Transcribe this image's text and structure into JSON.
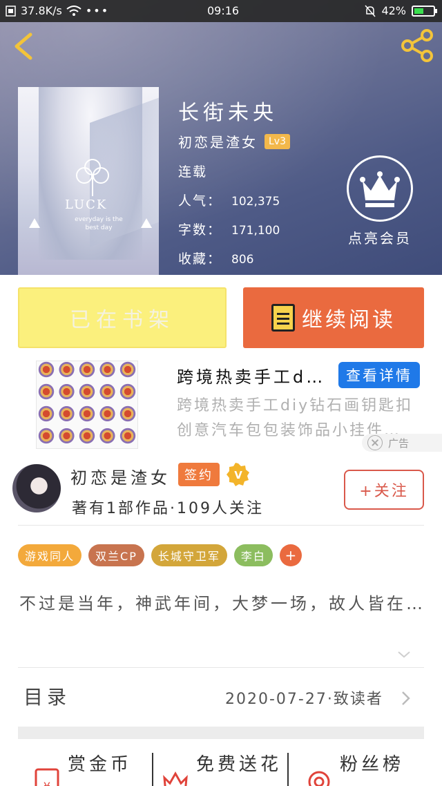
{
  "status_bar": {
    "net_speed": "37.8K/s",
    "time": "09:16",
    "battery": "42%"
  },
  "book": {
    "title": "长街未央",
    "author": "初恋是渣女",
    "level": "Lv3",
    "status": "连载",
    "popularity_label": "人气：",
    "popularity": "102,375",
    "word_count_label": "字数：",
    "word_count": "171,100",
    "favorites_label": "收藏：",
    "favorites": "806",
    "cover_text": "LUCK",
    "cover_sub": "everyday is the best day"
  },
  "vip": {
    "label": "点亮会员"
  },
  "actions": {
    "shelf_label": "已在书架",
    "read_label": "继续阅读"
  },
  "ad": {
    "title": "跨境热卖手工d…",
    "cta": "查看详情",
    "desc": "跨境热卖手工diy钻石画钥匙扣创意汽车包包装饰品小挂件…",
    "tag": "广告"
  },
  "author_card": {
    "name": "初恋是渣女",
    "sign_badge": "签约",
    "meta": "著有1部作品·109人关注",
    "follow": "+关注"
  },
  "tags": [
    {
      "label": "游戏同人",
      "color": "#f3a93b"
    },
    {
      "label": "双兰CP",
      "color": "#c8744f"
    },
    {
      "label": "长城守卫军",
      "color": "#d3a63a"
    },
    {
      "label": "李白",
      "color": "#8cbd5f"
    }
  ],
  "tag_plus": "+",
  "intro": "不过是当年，神武年间，大梦一场，故人皆在…",
  "toc": {
    "label": "目录",
    "meta": "2020-07-27·致读者"
  },
  "bottom": {
    "coin": "赏金币",
    "flower": "免费送花",
    "fans": "粉丝榜"
  },
  "colors": {
    "accent": "#ea6a3f",
    "shelf": "#fbf07d",
    "ad_cta": "#1f79e8",
    "follow": "#d9584a"
  }
}
